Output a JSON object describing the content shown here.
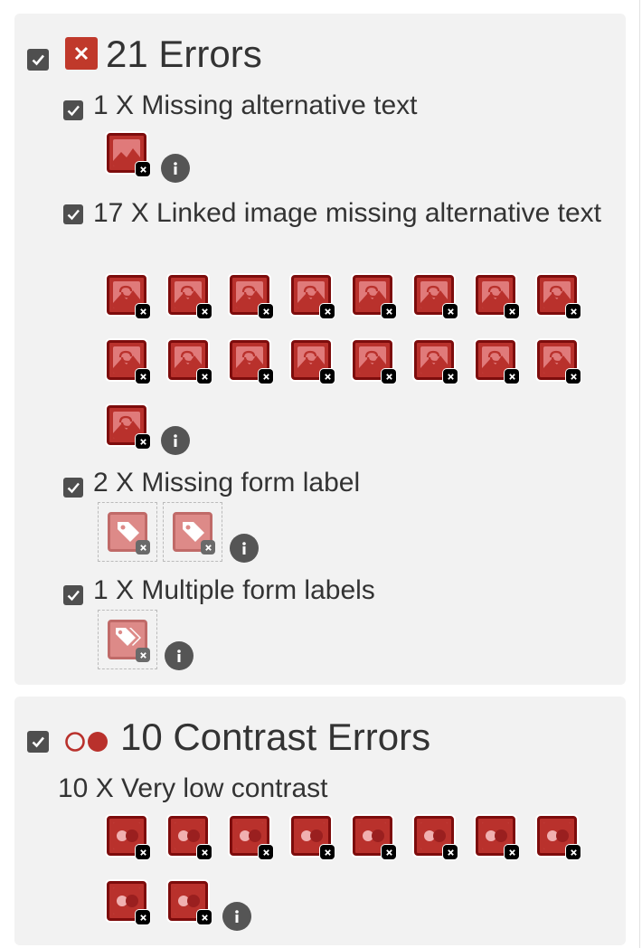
{
  "errors": {
    "title": "21 Errors",
    "items": [
      {
        "label": "1 X Missing alternative text",
        "count": 1,
        "icon": "image-missing-alt-icon"
      },
      {
        "label": "17 X Linked image missing alternative text",
        "count": 17,
        "icon": "linked-image-missing-alt-icon"
      },
      {
        "label": "2 X Missing form label",
        "count": 2,
        "icon": "tag-missing-label-icon"
      },
      {
        "label": "1 X Multiple form labels",
        "count": 1,
        "icon": "tags-multiple-labels-icon"
      }
    ]
  },
  "contrast": {
    "title": "10 Contrast Errors",
    "items": [
      {
        "label": "10 X Very low contrast",
        "count": 10,
        "icon": "very-low-contrast-icon"
      }
    ]
  },
  "colors": {
    "error_red": "#c0392b",
    "tile_dark": "#7d0c0c",
    "panel_bg": "#f2f2f2",
    "checkbox": "#4f4f4f",
    "info": "#555555"
  }
}
